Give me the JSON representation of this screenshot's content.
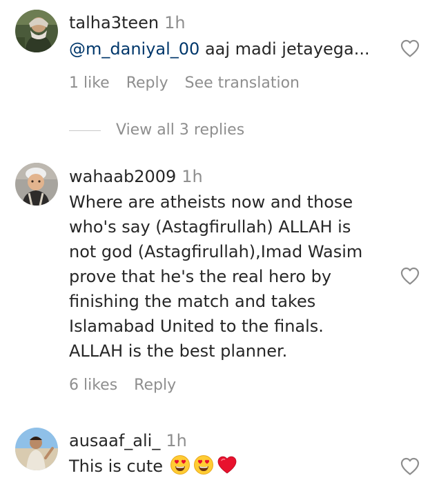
{
  "comments": [
    {
      "username": "talha3teen",
      "time": "1h",
      "mention": "@m_daniyal_00",
      "text": " aaj madi jetayega...",
      "likes": "1 like",
      "reply_label": "Reply",
      "translate_label": "See translation",
      "view_replies": "View all 3 replies"
    },
    {
      "username": "wahaab2009",
      "time": "1h",
      "text": "Where are atheists now and those\nwho's say (Astagfirullah) ALLAH is\nnot god (Astagfirullah),Imad Wasim\nprove that he's the real hero by\nfinishing the match and takes\nIslamabad United to the finals.\nALLAH is the best planner.",
      "likes": "6 likes",
      "reply_label": "Reply"
    },
    {
      "username": "ausaaf_ali_",
      "time": "1h",
      "text": "This is cute",
      "emojis": [
        "heart-eyes-emoji",
        "heart-eyes-emoji",
        "red-heart-emoji"
      ]
    }
  ],
  "colors": {
    "primary_text": "#262626",
    "secondary_text": "#8e8e8e",
    "mention": "#00376b",
    "heart_outline": "#8e8e8e",
    "emoji_face": "#ffcc33",
    "emoji_heart": "#e8112d"
  },
  "icons": {
    "like": "heart-outline-icon"
  }
}
